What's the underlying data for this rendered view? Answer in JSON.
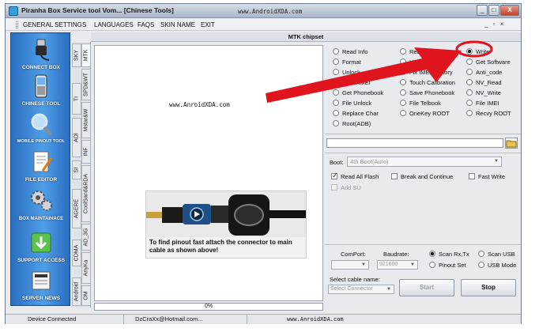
{
  "window": {
    "title": "Piranha Box Service tool Vom... [Chinese Tools]",
    "title_site": "www.AndroidXDA.com",
    "buttons": {
      "minimize": "_",
      "maximize": "□",
      "close": "X"
    },
    "mdi_controls": "_ ▫ ×"
  },
  "menu": [
    "GENERAL SETTINGS",
    "LANGUAGES",
    "FAQS",
    "SKIN NAME",
    "EXIT"
  ],
  "sidebar": [
    {
      "label": "CONNECT BOX",
      "icon": "usb-plug-icon"
    },
    {
      "label": "CHINESE TOOL",
      "icon": "phone-icon"
    },
    {
      "label": "MOBILE PINOUT TOOL",
      "icon": "magnifier-icon"
    },
    {
      "label": "FILE EDITOR",
      "icon": "document-pen-icon"
    },
    {
      "label": "BOX MAINTAINACE",
      "icon": "gears-icon"
    },
    {
      "label": "SUPPORT ACCESS",
      "icon": "download-icon"
    },
    {
      "label": "SERVER NEWS",
      "icon": "news-icon"
    }
  ],
  "vtabs_outer": [
    "SKY",
    "TI",
    "ADI",
    "SI",
    "AGERE",
    "CDMA",
    "Android"
  ],
  "vtabs_inner": [
    "MTK",
    "SPD&WT",
    "Mstar&W",
    "INF",
    "CoolSand&RDA",
    "AD_3G",
    "AnyKa",
    "OM"
  ],
  "chip_header": "MTK chipset",
  "log": {
    "site_text": "www.AnroidXDA.com",
    "pinout_caption": "To find pinout fast attach the connector to main cable as shown above!",
    "progress": "0%",
    "progress_value": 0
  },
  "operations": {
    "col1": [
      "Read Info",
      "Format",
      "Unlock",
      "Flash IMEI",
      "Get Phonebook",
      "File Unlock",
      "Replace Char",
      "Root(ADB)"
    ],
    "col2": [
      "Read",
      "Unlock",
      "Fix IMEI Factory",
      "Touch Calibration",
      "Save Phonebook",
      "File Telbook",
      "OneKey ROOT"
    ],
    "col3": [
      "Write",
      "Get Software",
      "Anti_code",
      "NV_Read",
      "NV_Write",
      "File IMEI",
      "Recvy ROOT"
    ],
    "selected": "Write"
  },
  "boot": {
    "label": "Boot:",
    "value": "4th Boot(Auto)"
  },
  "options": [
    {
      "label": "Read All Flash",
      "checked": true,
      "enabled": true
    },
    {
      "label": "Break and Continue",
      "checked": false,
      "enabled": true
    },
    {
      "label": "Fast Write",
      "checked": false,
      "enabled": true
    },
    {
      "label": "Add SU",
      "checked": false,
      "enabled": false
    }
  ],
  "connection": {
    "comport_label": "ComPort:",
    "baudrate_label": "Baudrate:",
    "baudrate_value": "921600",
    "scan_options": [
      "Scan Rx,Tx",
      "Scan USB",
      "Pinout Set",
      "USB Mode"
    ],
    "scan_selected": "Scan Rx,Tx",
    "cable_label": "Select cable name:",
    "cable_placeholder": "Select Connector",
    "start_label": "Start",
    "stop_label": "Stop"
  },
  "status": [
    "Device Connected",
    "DzCraXx@Hotmail.com...",
    "www.AnroidXDA.com"
  ],
  "colors": {
    "sidebar": "#3a86d8",
    "annotation_red": "#e0141c"
  }
}
